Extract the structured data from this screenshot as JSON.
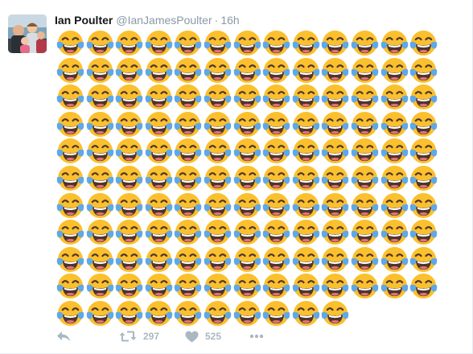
{
  "tweet": {
    "author_name": "Ian Poulter",
    "handle": "@IanJamesPoulter",
    "separator": "·",
    "time": "16h",
    "emoji_name": "face-with-tears-of-joy",
    "emoji_rows": [
      13,
      13,
      13,
      13,
      13,
      13,
      13,
      13,
      13,
      13,
      10
    ],
    "emoji_count": 140
  },
  "actions": {
    "reply_icon": "reply-icon",
    "retweet_icon": "retweet-icon",
    "retweet_count": "297",
    "like_icon": "heart-icon",
    "like_count": "525",
    "more_icon": "more-icon"
  },
  "colors": {
    "name": "#14171a",
    "secondary": "#8899a6",
    "action": "#aab8c2",
    "emoji_face": "#fbc02d",
    "emoji_tear": "#5fa8e8",
    "emoji_mouth": "#4e342e"
  }
}
